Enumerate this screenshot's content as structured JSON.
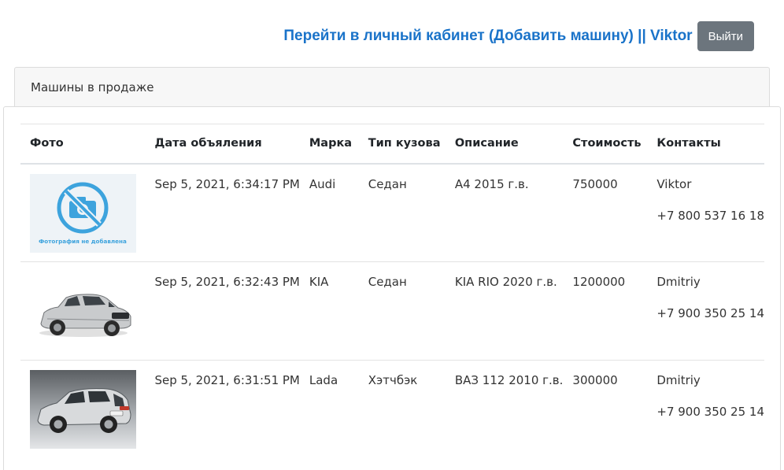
{
  "header": {
    "cabinet_link": "Перейти в личный кабинет (Добавить машину) || Viktor",
    "logout_label": "Выйти"
  },
  "card": {
    "title": "Машины в продаже"
  },
  "table": {
    "columns": [
      "Фото",
      "Дата объяления",
      "Марка",
      "Тип кузова",
      "Описание",
      "Стоимость",
      "Контакты"
    ],
    "rows": [
      {
        "photo": "no-photo-placeholder",
        "photo_caption": "Фотография не добавлена",
        "date": "Sep 5, 2021, 6:34:17 PM",
        "brand": "Audi",
        "body_type": "Седан",
        "description": "А4 2015 г.в.",
        "price": "750000",
        "contact_name": "Viktor",
        "contact_phone": "+7 800 537 16 18"
      },
      {
        "photo": "car-photo-kia-suv",
        "date": "Sep 5, 2021, 6:32:43 PM",
        "brand": "KIA",
        "body_type": "Седан",
        "description": "KIA RIO 2020 г.в.",
        "price": "1200000",
        "contact_name": "Dmitriy",
        "contact_phone": "+7 900 350 25 14"
      },
      {
        "photo": "car-photo-lada-hatchback",
        "date": "Sep 5, 2021, 6:31:51 PM",
        "brand": "Lada",
        "body_type": "Хэтчбэк",
        "description": "ВАЗ 112 2010 г.в.",
        "price": "300000",
        "contact_name": "Dmitriy",
        "contact_phone": "+7 900 350 25 14"
      }
    ]
  },
  "colors": {
    "link": "#1a73c9",
    "logout_button": "#6c757d",
    "placeholder_icon": "#3da3dd",
    "placeholder_bg": "#eef3f7"
  }
}
